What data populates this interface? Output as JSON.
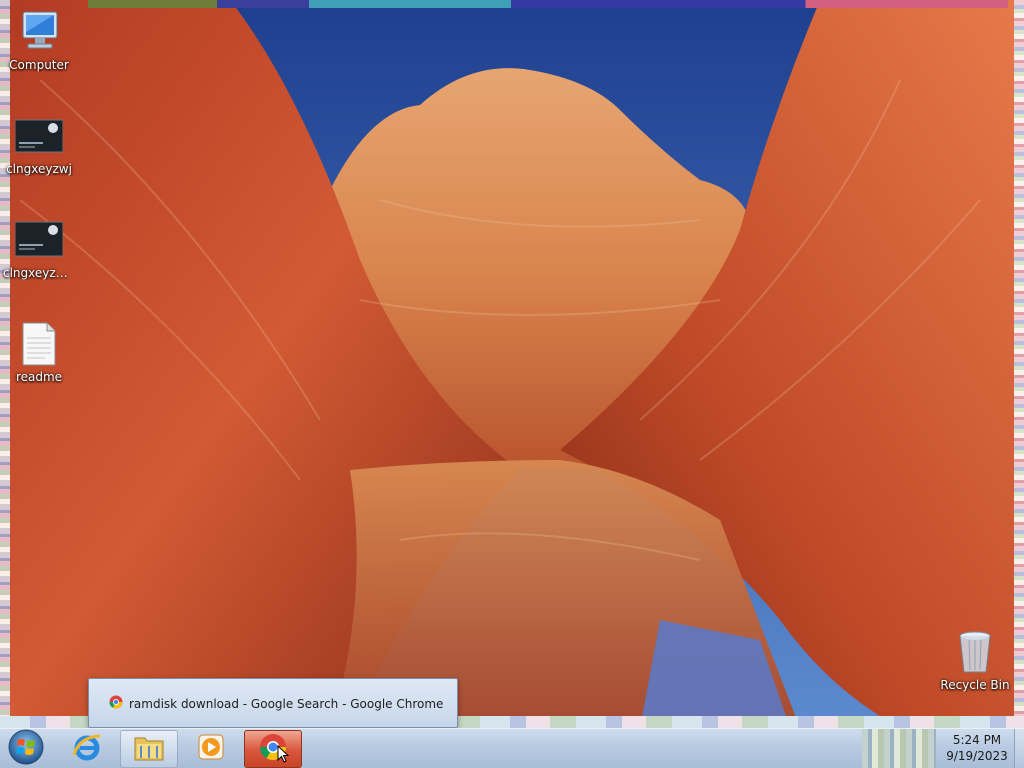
{
  "desktop": {
    "icons": [
      {
        "label": "Computer",
        "icon": "computer-icon"
      },
      {
        "label": "clngxeyzwj",
        "icon": "image-thumbnail-icon"
      },
      {
        "label": "clngxeyzwj-...",
        "icon": "image-thumbnail-icon"
      },
      {
        "label": "readme",
        "icon": "text-document-icon"
      },
      {
        "label": "Recycle Bin",
        "icon": "recycle-bin-icon"
      }
    ]
  },
  "thumbnail_tooltip": {
    "title": "ramdisk download - Google Search - Google Chrome",
    "icon": "chrome-icon"
  },
  "taskbar": {
    "start_icon": "windows-start-icon",
    "buttons": [
      {
        "icon": "internet-explorer-icon"
      },
      {
        "icon": "file-explorer-icon"
      },
      {
        "icon": "media-player-icon"
      },
      {
        "icon": "chrome-icon",
        "active": true
      }
    ],
    "clock": {
      "time": "5:24 PM",
      "date": "9/19/2023"
    }
  },
  "colors": {
    "taskbar": "#b9cbe2",
    "active_button": "#d8563c",
    "tooltip_bg": "#dfe9f5"
  }
}
